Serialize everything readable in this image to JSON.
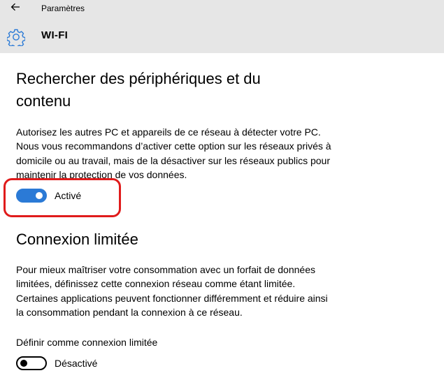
{
  "header": {
    "back_icon": "arrow-left-icon",
    "app_title": "Paramètres",
    "page_icon": "gear-icon",
    "page_title": "WI-FI",
    "background": "#e6e6e6"
  },
  "discovery": {
    "heading": "Rechercher des périphériques et du contenu",
    "description": "Autorisez les autres PC et appareils de ce réseau à détecter votre PC. Nous vous recommandons d’activer cette option sur les réseaux privés à domicile ou au travail, mais de la désactiver sur les réseaux publics pour maintenir la protection de vos données.",
    "toggle_state": true,
    "toggle_label": "Activé",
    "highlight_color": "#e01b1b"
  },
  "metered": {
    "heading": "Connexion limitée",
    "description": "Pour mieux maîtriser votre consommation avec un forfait de données limitées, définissez cette connexion réseau comme étant limitée. Certaines applications peuvent fonctionner différemment et réduire ainsi la consommation pendant la connexion à ce réseau.",
    "field_label": "Définir comme connexion limitée",
    "toggle_state": false,
    "toggle_label": "Désactivé"
  },
  "colors": {
    "accent": "#2b7ad6"
  }
}
